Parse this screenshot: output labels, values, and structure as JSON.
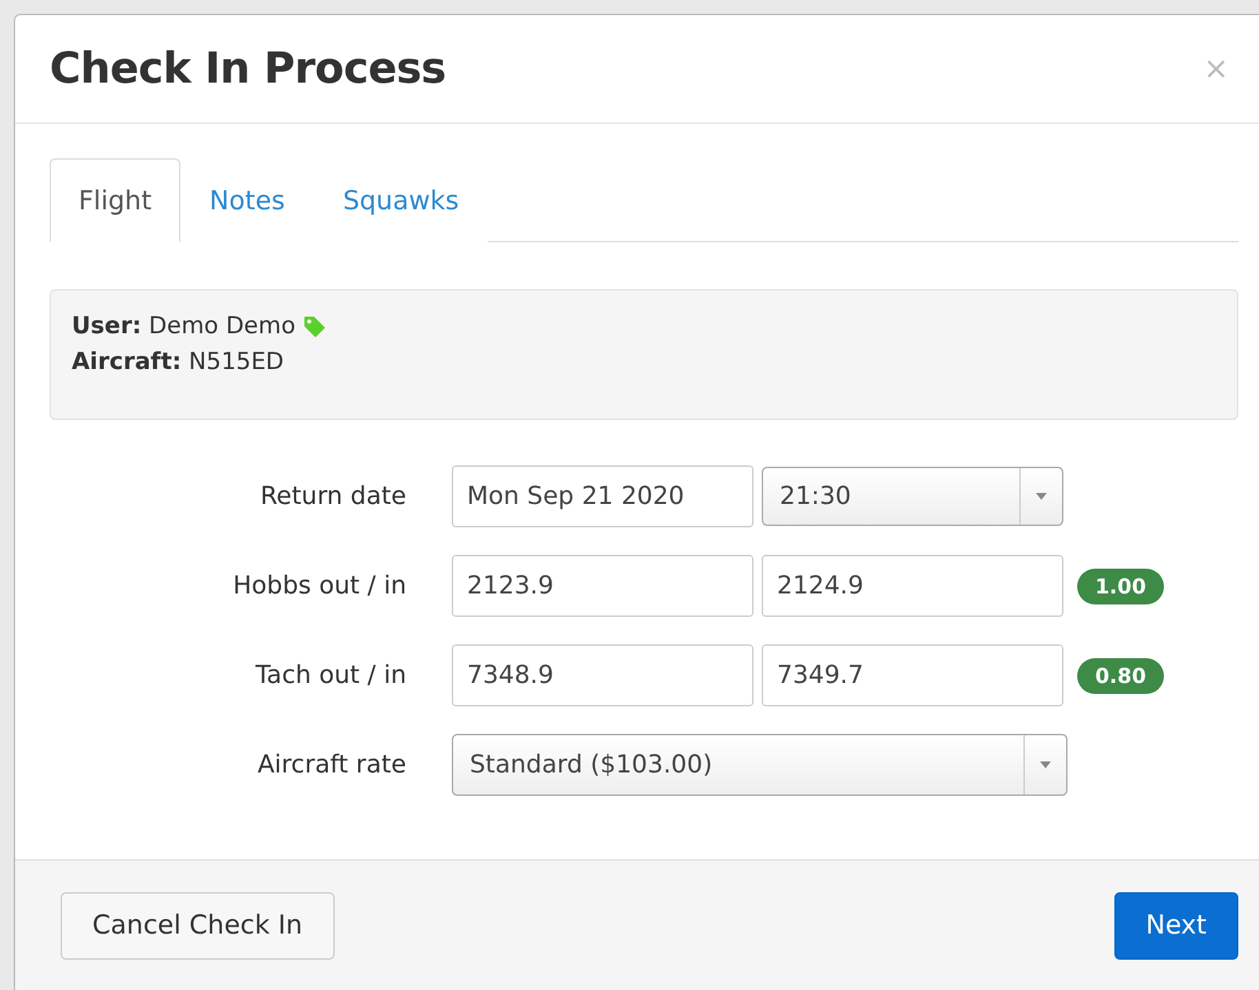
{
  "dialog": {
    "title": "Check In Process",
    "close": "×"
  },
  "tabs": [
    {
      "label": "Flight",
      "selected": true
    },
    {
      "label": "Notes",
      "selected": false
    },
    {
      "label": "Squawks",
      "selected": false
    }
  ],
  "info": {
    "user_label": "User:",
    "user": "Demo Demo",
    "aircraft_label": "Aircraft:",
    "aircraft": "N515ED"
  },
  "rows": [
    {
      "kind": "date_time",
      "label": "Return date",
      "date": "Mon Sep 21 2020",
      "time": "21:30"
    },
    {
      "kind": "range",
      "label": "Hobbs out / in",
      "out": "2123.9",
      "in": "2124.9",
      "badge": "1.00"
    },
    {
      "kind": "range",
      "label": "Tach out / in",
      "out": "7348.9",
      "in": "7349.7",
      "badge": "0.80"
    },
    {
      "kind": "select",
      "label": "Aircraft rate",
      "value": "Standard ($103.00)"
    }
  ],
  "buttons": {
    "cancel": "Cancel Check In",
    "next": "Next"
  }
}
